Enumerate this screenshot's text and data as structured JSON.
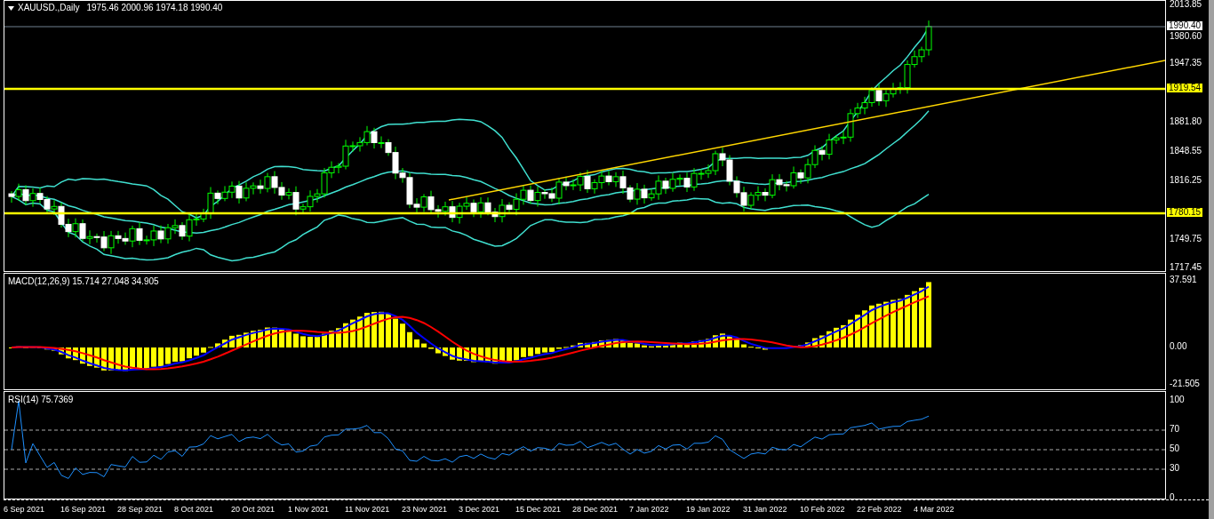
{
  "main_chart": {
    "symbol": "XAUUSD.,Daily",
    "ohlc": "1975.46 2000.96 1974.18 1990.40",
    "price_axis": [
      "2013.85",
      "1980.60",
      "1947.35",
      "1881.80",
      "1848.55",
      "1816.25",
      "1749.75",
      "1717.45"
    ],
    "price_tags": [
      {
        "text": "1990.40",
        "kind": "bid"
      },
      {
        "text": "1919.54",
        "kind": "level"
      },
      {
        "text": "1780.15",
        "kind": "level"
      }
    ]
  },
  "macd": {
    "title": "MACD(12,26,9) 15.714 27.048 34.905",
    "axis": [
      "37.591",
      "0.00",
      "-21.505"
    ]
  },
  "rsi": {
    "title": "RSI(14) 75.7369",
    "axis": [
      "100",
      "70",
      "50",
      "30",
      "0"
    ]
  },
  "time_axis": [
    "6 Sep 2021",
    "16 Sep 2021",
    "28 Sep 2021",
    "8 Oct 2021",
    "20 Oct 2021",
    "1 Nov 2021",
    "11 Nov 2021",
    "23 Nov 2021",
    "3 Dec 2021",
    "15 Dec 2021",
    "28 Dec 2021",
    "7 Jan 2022",
    "19 Jan 2022",
    "31 Jan 2022",
    "10 Feb 2022",
    "22 Feb 2022",
    "4 Mar 2022"
  ]
}
